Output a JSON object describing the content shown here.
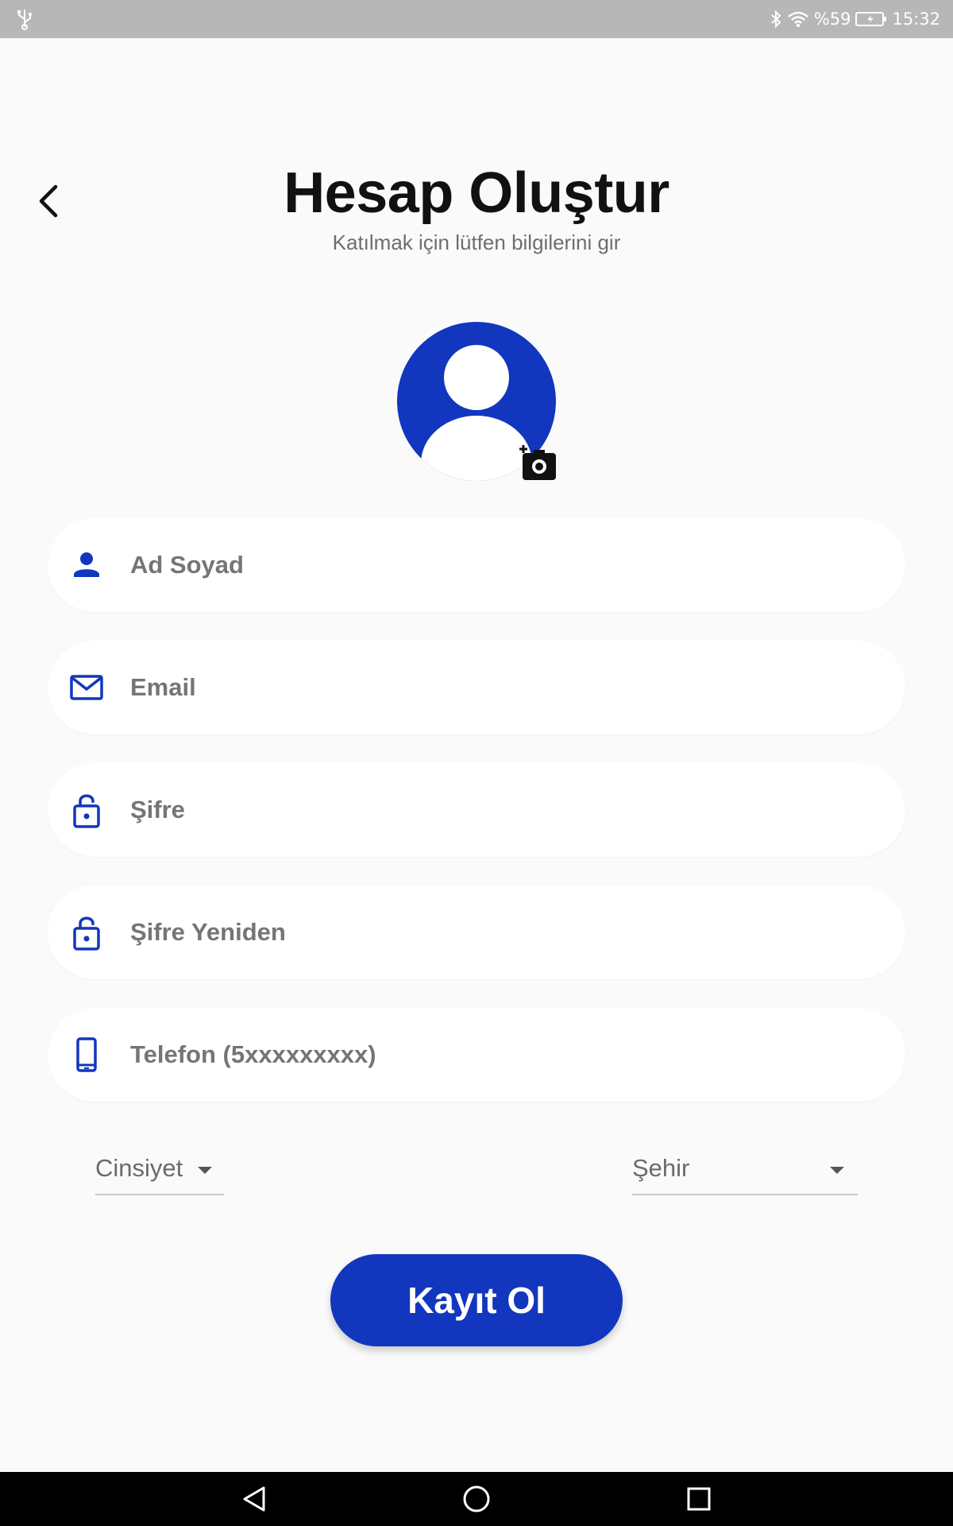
{
  "status_bar": {
    "battery": "%59",
    "time": "15:32"
  },
  "header": {
    "title": "Hesap Oluştur",
    "subtitle": "Katılmak için lütfen bilgilerini gir"
  },
  "form": {
    "fields": [
      {
        "placeholder": "Ad Soyad",
        "icon": "person-icon"
      },
      {
        "placeholder": "Email",
        "icon": "mail-icon"
      },
      {
        "placeholder": "Şifre",
        "icon": "lock-icon"
      },
      {
        "placeholder": "Şifre Yeniden",
        "icon": "lock-icon"
      },
      {
        "placeholder": "Telefon (5xxxxxxxxx)",
        "icon": "phone-icon"
      }
    ],
    "gender_dropdown": "Cinsiyet",
    "city_dropdown": "Şehir",
    "submit_label": "Kayıt Ol"
  },
  "colors": {
    "primary": "#1237be",
    "background": "#fafafa",
    "field_background": "#ffffff"
  }
}
